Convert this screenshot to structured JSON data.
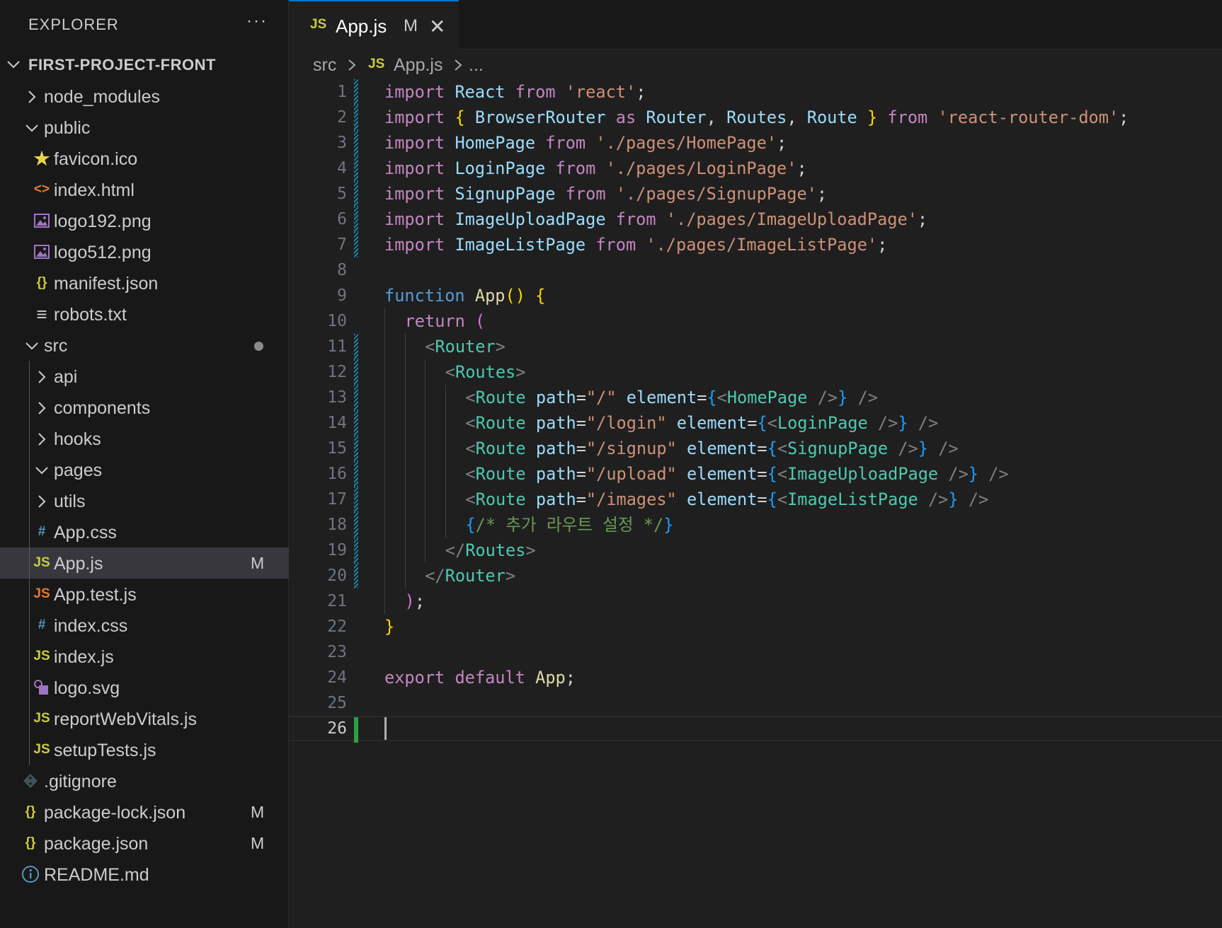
{
  "explorer": {
    "title": "EXPLORER",
    "more": "···",
    "project": "FIRST-PROJECT-FRONT",
    "items": [
      {
        "label": "node_modules",
        "kind": "folder",
        "open": false,
        "depth": 1
      },
      {
        "label": "public",
        "kind": "folder",
        "open": true,
        "depth": 1
      },
      {
        "label": "favicon.ico",
        "kind": "file",
        "icon": "star-icon",
        "glyph": "★",
        "color": "#e8d44d",
        "depth": 2
      },
      {
        "label": "index.html",
        "kind": "file",
        "icon": "html-icon",
        "glyph": "<>",
        "color": "#e37933",
        "depth": 2
      },
      {
        "label": "logo192.png",
        "kind": "file",
        "icon": "image-icon",
        "glyph": "img",
        "color": "#a074c4",
        "depth": 2
      },
      {
        "label": "logo512.png",
        "kind": "file",
        "icon": "image-icon",
        "glyph": "img",
        "color": "#a074c4",
        "depth": 2
      },
      {
        "label": "manifest.json",
        "kind": "file",
        "icon": "json-icon",
        "glyph": "{}",
        "color": "#cbcb41",
        "depth": 2
      },
      {
        "label": "robots.txt",
        "kind": "file",
        "icon": "text-file-icon",
        "glyph": "≡",
        "color": "#cccccc",
        "depth": 2
      },
      {
        "label": "src",
        "kind": "folder",
        "open": true,
        "depth": 1,
        "dot": true
      },
      {
        "label": "api",
        "kind": "folder",
        "open": false,
        "depth": 2
      },
      {
        "label": "components",
        "kind": "folder",
        "open": false,
        "depth": 2
      },
      {
        "label": "hooks",
        "kind": "folder",
        "open": false,
        "depth": 2
      },
      {
        "label": "pages",
        "kind": "folder",
        "open": true,
        "depth": 2
      },
      {
        "label": "utils",
        "kind": "folder",
        "open": false,
        "depth": 2
      },
      {
        "label": "App.css",
        "kind": "file",
        "icon": "css-icon",
        "glyph": "#",
        "color": "#519aba",
        "depth": 2
      },
      {
        "label": "App.js",
        "kind": "file",
        "icon": "js-icon",
        "glyph": "JS",
        "color": "#cbcb41",
        "depth": 2,
        "badge": "M",
        "selected": true
      },
      {
        "label": "App.test.js",
        "kind": "file",
        "icon": "js-test-icon",
        "glyph": "JS",
        "color": "#e37933",
        "depth": 2
      },
      {
        "label": "index.css",
        "kind": "file",
        "icon": "css-icon",
        "glyph": "#",
        "color": "#519aba",
        "depth": 2
      },
      {
        "label": "index.js",
        "kind": "file",
        "icon": "js-icon",
        "glyph": "JS",
        "color": "#cbcb41",
        "depth": 2
      },
      {
        "label": "logo.svg",
        "kind": "file",
        "icon": "svg-icon",
        "glyph": "svg",
        "color": "#a074c4",
        "depth": 2
      },
      {
        "label": "reportWebVitals.js",
        "kind": "file",
        "icon": "js-icon",
        "glyph": "JS",
        "color": "#cbcb41",
        "depth": 2
      },
      {
        "label": "setupTests.js",
        "kind": "file",
        "icon": "js-icon",
        "glyph": "JS",
        "color": "#cbcb41",
        "depth": 2
      },
      {
        "label": ".gitignore",
        "kind": "file",
        "icon": "git-icon",
        "glyph": "◆",
        "color": "#41535b",
        "depth": 1
      },
      {
        "label": "package-lock.json",
        "kind": "file",
        "icon": "json-icon",
        "glyph": "{}",
        "color": "#cbcb41",
        "depth": 1,
        "badge": "M"
      },
      {
        "label": "package.json",
        "kind": "file",
        "icon": "json-icon",
        "glyph": "{}",
        "color": "#cbcb41",
        "depth": 1,
        "badge": "M"
      },
      {
        "label": "README.md",
        "kind": "file",
        "icon": "info-icon",
        "glyph": "i",
        "color": "#519aba",
        "depth": 1
      }
    ]
  },
  "tab": {
    "icon": "JS",
    "name": "App.js",
    "modified": "M",
    "close": "✕"
  },
  "breadcrumb": {
    "folder": "src",
    "icon": "JS",
    "file": "App.js",
    "more": "..."
  },
  "editor": {
    "current_line": 26,
    "lines": [
      {
        "n": "1",
        "gutter": "mod",
        "indent": 0,
        "tokens": [
          [
            "kw",
            "import"
          ],
          [
            "pl",
            " "
          ],
          [
            "var",
            "React"
          ],
          [
            "pl",
            " "
          ],
          [
            "kw",
            "from"
          ],
          [
            "pl",
            " "
          ],
          [
            "str",
            "'react'"
          ],
          [
            "pl",
            ";"
          ]
        ]
      },
      {
        "n": "2",
        "gutter": "mod",
        "indent": 0,
        "tokens": [
          [
            "kw",
            "import"
          ],
          [
            "pl",
            " "
          ],
          [
            "p1",
            "{"
          ],
          [
            "pl",
            " "
          ],
          [
            "var",
            "BrowserRouter"
          ],
          [
            "pl",
            " "
          ],
          [
            "kw",
            "as"
          ],
          [
            "pl",
            " "
          ],
          [
            "var",
            "Router"
          ],
          [
            "pl",
            ", "
          ],
          [
            "var",
            "Routes"
          ],
          [
            "pl",
            ", "
          ],
          [
            "var",
            "Route"
          ],
          [
            "pl",
            " "
          ],
          [
            "p1",
            "}"
          ],
          [
            "pl",
            " "
          ],
          [
            "kw",
            "from"
          ],
          [
            "pl",
            " "
          ],
          [
            "str",
            "'react-router-dom'"
          ],
          [
            "pl",
            ";"
          ]
        ]
      },
      {
        "n": "3",
        "gutter": "mod",
        "indent": 0,
        "tokens": [
          [
            "kw",
            "import"
          ],
          [
            "pl",
            " "
          ],
          [
            "var",
            "HomePage"
          ],
          [
            "pl",
            " "
          ],
          [
            "kw",
            "from"
          ],
          [
            "pl",
            " "
          ],
          [
            "str",
            "'./pages/HomePage'"
          ],
          [
            "pl",
            ";"
          ]
        ]
      },
      {
        "n": "4",
        "gutter": "mod",
        "indent": 0,
        "tokens": [
          [
            "kw",
            "import"
          ],
          [
            "pl",
            " "
          ],
          [
            "var",
            "LoginPage"
          ],
          [
            "pl",
            " "
          ],
          [
            "kw",
            "from"
          ],
          [
            "pl",
            " "
          ],
          [
            "str",
            "'./pages/LoginPage'"
          ],
          [
            "pl",
            ";"
          ]
        ]
      },
      {
        "n": "5",
        "gutter": "mod",
        "indent": 0,
        "tokens": [
          [
            "kw",
            "import"
          ],
          [
            "pl",
            " "
          ],
          [
            "var",
            "SignupPage"
          ],
          [
            "pl",
            " "
          ],
          [
            "kw",
            "from"
          ],
          [
            "pl",
            " "
          ],
          [
            "str",
            "'./pages/SignupPage'"
          ],
          [
            "pl",
            ";"
          ]
        ]
      },
      {
        "n": "6",
        "gutter": "mod",
        "indent": 0,
        "tokens": [
          [
            "kw",
            "import"
          ],
          [
            "pl",
            " "
          ],
          [
            "var",
            "ImageUploadPage"
          ],
          [
            "pl",
            " "
          ],
          [
            "kw",
            "from"
          ],
          [
            "pl",
            " "
          ],
          [
            "str",
            "'./pages/ImageUploadPage'"
          ],
          [
            "pl",
            ";"
          ]
        ]
      },
      {
        "n": "7",
        "gutter": "mod",
        "indent": 0,
        "tokens": [
          [
            "kw",
            "import"
          ],
          [
            "pl",
            " "
          ],
          [
            "var",
            "ImageListPage"
          ],
          [
            "pl",
            " "
          ],
          [
            "kw",
            "from"
          ],
          [
            "pl",
            " "
          ],
          [
            "str",
            "'./pages/ImageListPage'"
          ],
          [
            "pl",
            ";"
          ]
        ]
      },
      {
        "n": "8",
        "gutter": "",
        "indent": 0,
        "tokens": []
      },
      {
        "n": "9",
        "gutter": "",
        "indent": 0,
        "tokens": [
          [
            "fn",
            "function"
          ],
          [
            "pl",
            " "
          ],
          [
            "name",
            "App"
          ],
          [
            "p1",
            "()"
          ],
          [
            "pl",
            " "
          ],
          [
            "p1",
            "{"
          ]
        ]
      },
      {
        "n": "10",
        "gutter": "",
        "indent": 1,
        "tokens": [
          [
            "kw",
            "return"
          ],
          [
            "pl",
            " "
          ],
          [
            "p2",
            "("
          ]
        ]
      },
      {
        "n": "11",
        "gutter": "mod",
        "indent": 2,
        "tokens": [
          [
            "br",
            "<"
          ],
          [
            "tag",
            "Router"
          ],
          [
            "br",
            ">"
          ]
        ]
      },
      {
        "n": "12",
        "gutter": "mod",
        "indent": 3,
        "tokens": [
          [
            "br",
            "<"
          ],
          [
            "tag",
            "Routes"
          ],
          [
            "br",
            ">"
          ]
        ]
      },
      {
        "n": "13",
        "gutter": "mod",
        "indent": 4,
        "tokens": [
          [
            "br",
            "<"
          ],
          [
            "tag",
            "Route"
          ],
          [
            "pl",
            " "
          ],
          [
            "var",
            "path"
          ],
          [
            "op",
            "="
          ],
          [
            "str",
            "\"/\""
          ],
          [
            "pl",
            " "
          ],
          [
            "var",
            "element"
          ],
          [
            "op",
            "="
          ],
          [
            "p3",
            "{"
          ],
          [
            "br",
            "<"
          ],
          [
            "tag",
            "HomePage"
          ],
          [
            "pl",
            " "
          ],
          [
            "br",
            "/>"
          ],
          [
            "p3",
            "}"
          ],
          [
            "pl",
            " "
          ],
          [
            "br",
            "/>"
          ]
        ]
      },
      {
        "n": "14",
        "gutter": "mod",
        "indent": 4,
        "tokens": [
          [
            "br",
            "<"
          ],
          [
            "tag",
            "Route"
          ],
          [
            "pl",
            " "
          ],
          [
            "var",
            "path"
          ],
          [
            "op",
            "="
          ],
          [
            "str",
            "\"/login\""
          ],
          [
            "pl",
            " "
          ],
          [
            "var",
            "element"
          ],
          [
            "op",
            "="
          ],
          [
            "p3",
            "{"
          ],
          [
            "br",
            "<"
          ],
          [
            "tag",
            "LoginPage"
          ],
          [
            "pl",
            " "
          ],
          [
            "br",
            "/>"
          ],
          [
            "p3",
            "}"
          ],
          [
            "pl",
            " "
          ],
          [
            "br",
            "/>"
          ]
        ]
      },
      {
        "n": "15",
        "gutter": "mod",
        "indent": 4,
        "tokens": [
          [
            "br",
            "<"
          ],
          [
            "tag",
            "Route"
          ],
          [
            "pl",
            " "
          ],
          [
            "var",
            "path"
          ],
          [
            "op",
            "="
          ],
          [
            "str",
            "\"/signup\""
          ],
          [
            "pl",
            " "
          ],
          [
            "var",
            "element"
          ],
          [
            "op",
            "="
          ],
          [
            "p3",
            "{"
          ],
          [
            "br",
            "<"
          ],
          [
            "tag",
            "SignupPage"
          ],
          [
            "pl",
            " "
          ],
          [
            "br",
            "/>"
          ],
          [
            "p3",
            "}"
          ],
          [
            "pl",
            " "
          ],
          [
            "br",
            "/>"
          ]
        ]
      },
      {
        "n": "16",
        "gutter": "mod",
        "indent": 4,
        "tokens": [
          [
            "br",
            "<"
          ],
          [
            "tag",
            "Route"
          ],
          [
            "pl",
            " "
          ],
          [
            "var",
            "path"
          ],
          [
            "op",
            "="
          ],
          [
            "str",
            "\"/upload\""
          ],
          [
            "pl",
            " "
          ],
          [
            "var",
            "element"
          ],
          [
            "op",
            "="
          ],
          [
            "p3",
            "{"
          ],
          [
            "br",
            "<"
          ],
          [
            "tag",
            "ImageUploadPage"
          ],
          [
            "pl",
            " "
          ],
          [
            "br",
            "/>"
          ],
          [
            "p3",
            "}"
          ],
          [
            "pl",
            " "
          ],
          [
            "br",
            "/>"
          ]
        ]
      },
      {
        "n": "17",
        "gutter": "mod",
        "indent": 4,
        "tokens": [
          [
            "br",
            "<"
          ],
          [
            "tag",
            "Route"
          ],
          [
            "pl",
            " "
          ],
          [
            "var",
            "path"
          ],
          [
            "op",
            "="
          ],
          [
            "str",
            "\"/images\""
          ],
          [
            "pl",
            " "
          ],
          [
            "var",
            "element"
          ],
          [
            "op",
            "="
          ],
          [
            "p3",
            "{"
          ],
          [
            "br",
            "<"
          ],
          [
            "tag",
            "ImageListPage"
          ],
          [
            "pl",
            " "
          ],
          [
            "br",
            "/>"
          ],
          [
            "p3",
            "}"
          ],
          [
            "pl",
            " "
          ],
          [
            "br",
            "/>"
          ]
        ]
      },
      {
        "n": "18",
        "gutter": "mod",
        "indent": 4,
        "tokens": [
          [
            "p3",
            "{"
          ],
          [
            "cm",
            "/* 추가 라우트 설정 */"
          ],
          [
            "p3",
            "}"
          ]
        ]
      },
      {
        "n": "19",
        "gutter": "mod",
        "indent": 3,
        "tokens": [
          [
            "br",
            "</"
          ],
          [
            "tag",
            "Routes"
          ],
          [
            "br",
            ">"
          ]
        ]
      },
      {
        "n": "20",
        "gutter": "mod",
        "indent": 2,
        "tokens": [
          [
            "br",
            "</"
          ],
          [
            "tag",
            "Router"
          ],
          [
            "br",
            ">"
          ]
        ]
      },
      {
        "n": "21",
        "gutter": "",
        "indent": 1,
        "tokens": [
          [
            "p2",
            ")"
          ],
          [
            "pl",
            ";"
          ]
        ]
      },
      {
        "n": "22",
        "gutter": "",
        "indent": 0,
        "tokens": [
          [
            "p1",
            "}"
          ]
        ]
      },
      {
        "n": "23",
        "gutter": "",
        "indent": 0,
        "tokens": []
      },
      {
        "n": "24",
        "gutter": "",
        "indent": 0,
        "tokens": [
          [
            "kw",
            "export"
          ],
          [
            "pl",
            " "
          ],
          [
            "kw",
            "default"
          ],
          [
            "pl",
            " "
          ],
          [
            "name",
            "App"
          ],
          [
            "pl",
            ";"
          ]
        ]
      },
      {
        "n": "25",
        "gutter": "",
        "indent": 0,
        "tokens": []
      },
      {
        "n": "26",
        "gutter": "add",
        "indent": 0,
        "tokens": []
      }
    ]
  }
}
